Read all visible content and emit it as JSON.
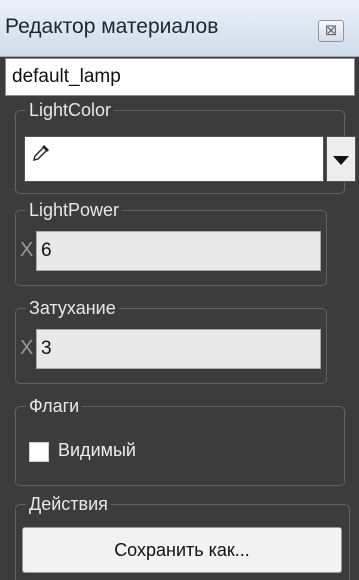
{
  "window": {
    "title": "Редактор материалов",
    "close_symbol": "⊠"
  },
  "material_name": "default_lamp",
  "light_color": {
    "label": "LightColor",
    "swatch_value": "#ffffff",
    "picker_icon": "eyedropper-icon",
    "dropdown_icon": "dropdown-arrow-icon"
  },
  "light_power": {
    "label": "LightPower",
    "prefix": "X",
    "value": "6"
  },
  "attenuation": {
    "label": "Затухание",
    "prefix": "X",
    "value": "3"
  },
  "flags": {
    "label": "Флаги",
    "visible_label": "Видимый",
    "visible_checked": false
  },
  "actions": {
    "label": "Действия",
    "save_as_label": "Сохранить как..."
  },
  "colors": {
    "panel_bg": "#3c3c3c",
    "titlebar_top": "#eaf1f9",
    "titlebar_bottom": "#cfdcea",
    "field_bg": "#e8e8e8"
  }
}
